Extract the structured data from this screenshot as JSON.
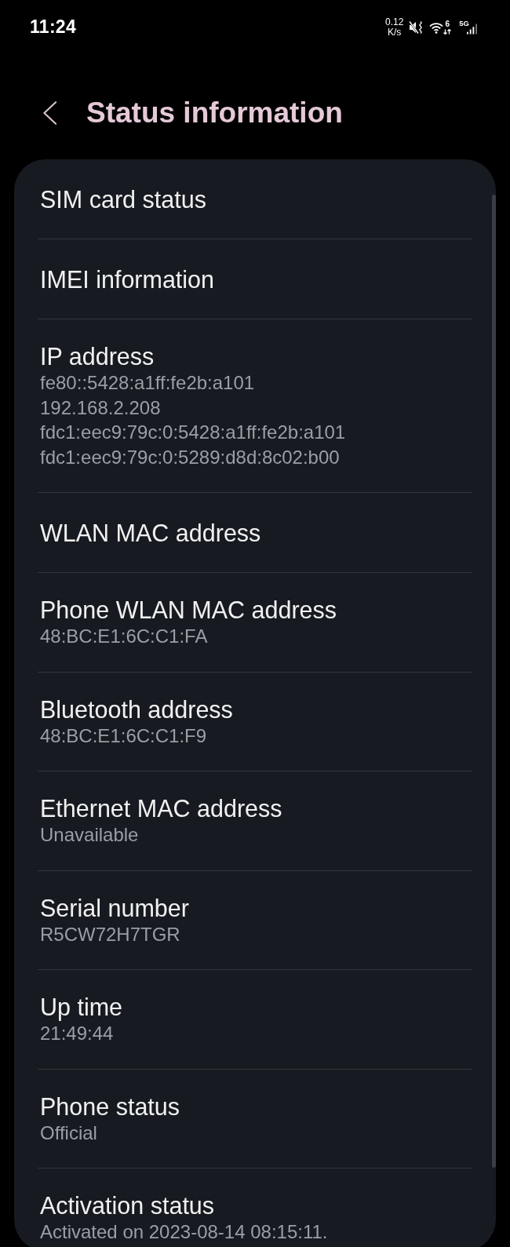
{
  "status_bar": {
    "time": "11:24",
    "network_speed": [
      "0.12",
      "K/s"
    ],
    "wifi_label": "6",
    "network_type": "5G"
  },
  "header": {
    "title": "Status information"
  },
  "items": [
    {
      "title": "SIM card status"
    },
    {
      "title": "IMEI information"
    },
    {
      "title": "IP address",
      "values": [
        "fe80::5428:a1ff:fe2b:a101",
        "192.168.2.208",
        "fdc1:eec9:79c:0:5428:a1ff:fe2b:a101",
        "fdc1:eec9:79c:0:5289:d8d:8c02:b00"
      ]
    },
    {
      "title": "WLAN MAC address"
    },
    {
      "title": "Phone WLAN MAC address",
      "values": [
        "48:BC:E1:6C:C1:FA"
      ]
    },
    {
      "title": "Bluetooth address",
      "values": [
        "48:BC:E1:6C:C1:F9"
      ]
    },
    {
      "title": "Ethernet MAC address",
      "values": [
        "Unavailable"
      ]
    },
    {
      "title": "Serial number",
      "values": [
        "R5CW72H7TGR"
      ]
    },
    {
      "title": "Up time",
      "values": [
        "21:49:44"
      ]
    },
    {
      "title": "Phone status",
      "values": [
        "Official"
      ]
    },
    {
      "title": "Activation status",
      "values": [
        "Activated on 2023-08-14 08:15:11."
      ]
    }
  ]
}
